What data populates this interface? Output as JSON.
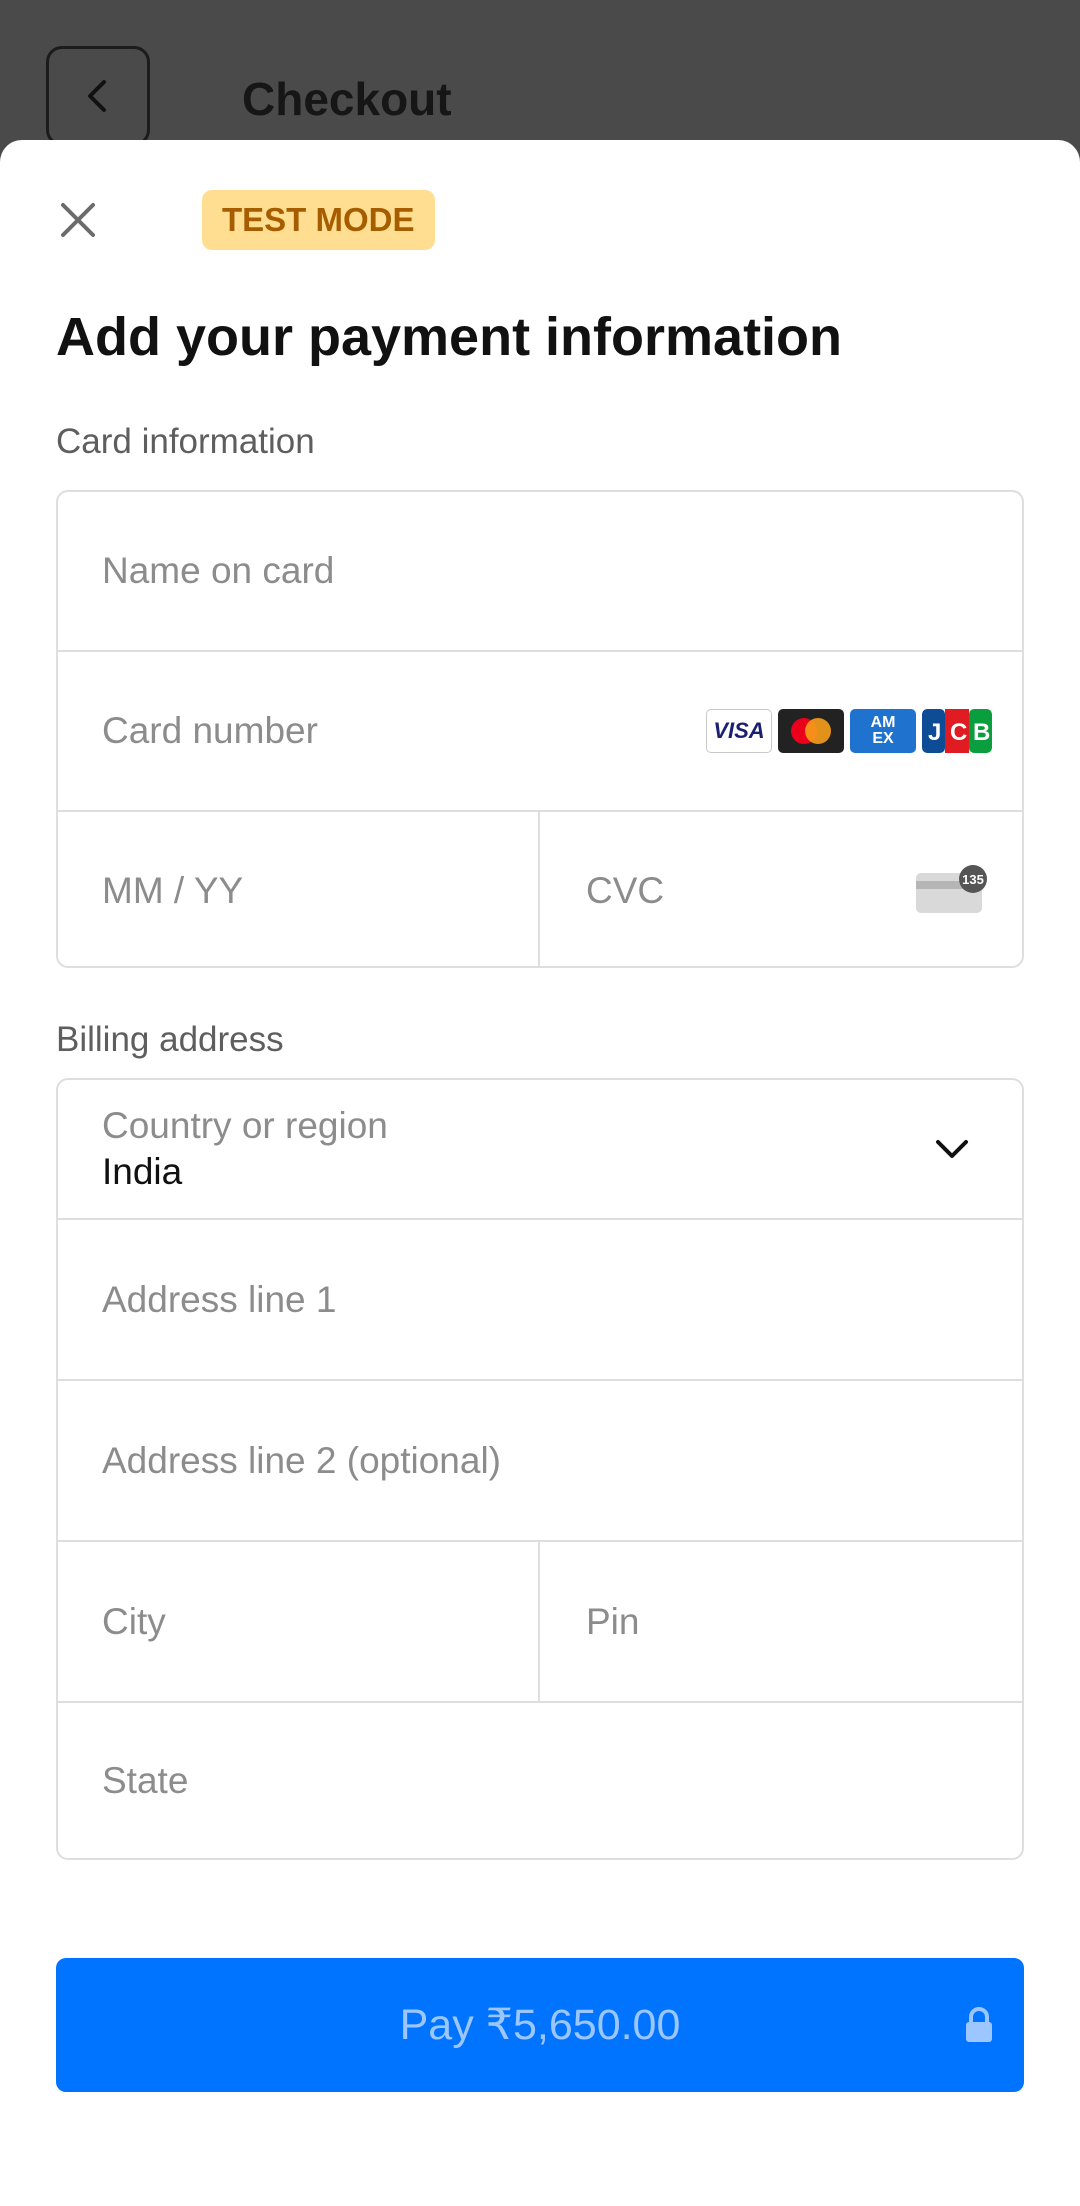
{
  "background": {
    "title": "Checkout"
  },
  "sheet": {
    "badge": "TEST MODE",
    "heading": "Add your payment information"
  },
  "card_section": {
    "label": "Card information",
    "name_placeholder": "Name on card",
    "number_placeholder": "Card number",
    "expiry_placeholder": "MM / YY",
    "cvc_placeholder": "CVC",
    "cvc_icon_number": "135",
    "brands": [
      "VISA",
      "Mastercard",
      "AMEX",
      "JCB"
    ]
  },
  "billing_section": {
    "label": "Billing address",
    "country_label": "Country or region",
    "country_value": "India",
    "address1_placeholder": "Address line 1",
    "address2_placeholder": "Address line 2 (optional)",
    "city_placeholder": "City",
    "pin_placeholder": "Pin",
    "state_placeholder": "State"
  },
  "pay_button": {
    "label": "Pay ₹5,650.00"
  },
  "colors": {
    "accent": "#0074ff",
    "badge_bg": "#ffde92",
    "badge_text": "#a65d00"
  }
}
